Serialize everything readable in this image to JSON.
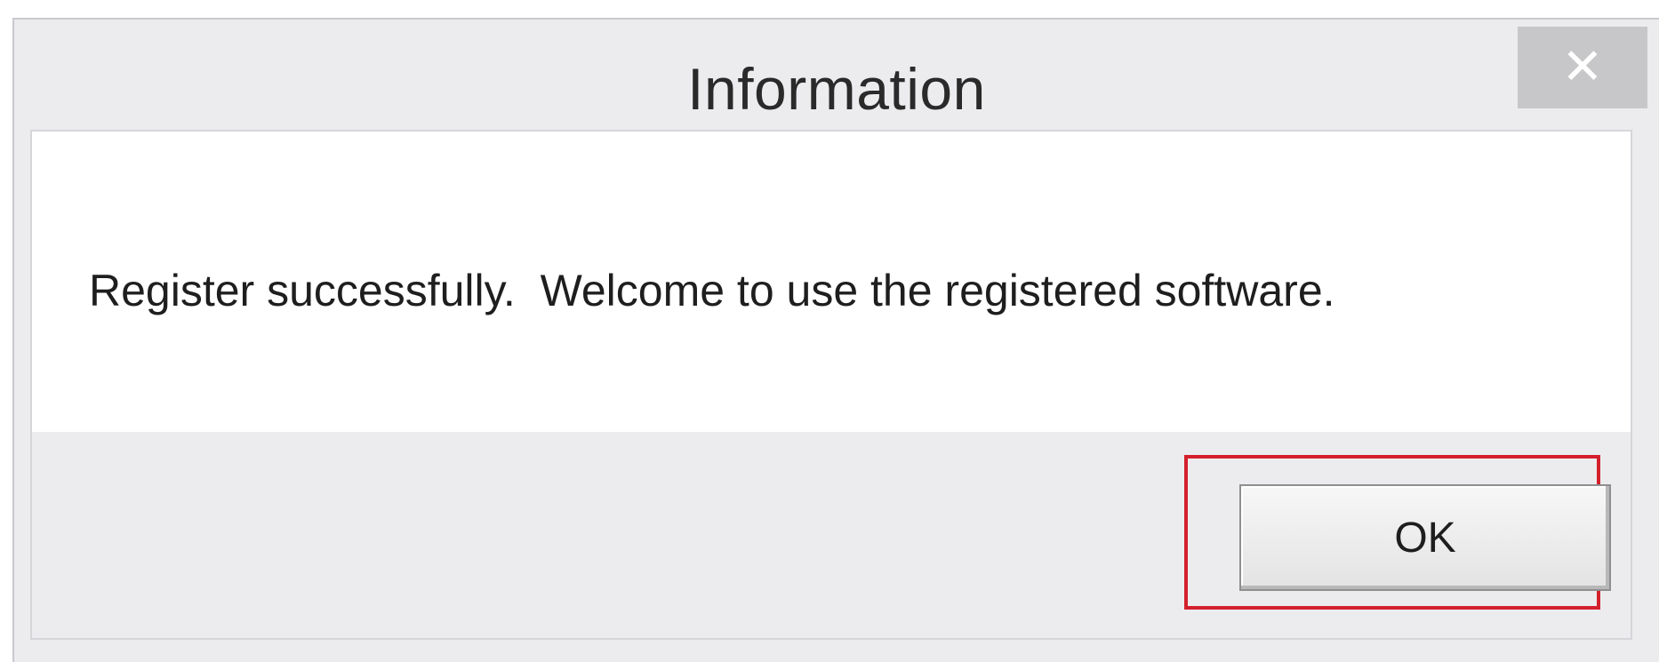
{
  "window": {
    "title": "Information",
    "close_icon": "close-icon",
    "close_glyph": "✕"
  },
  "message": {
    "text": "Register successfully.  Welcome to use the registered software."
  },
  "buttons": {
    "ok_label": "OK"
  },
  "colors": {
    "dialog_background": "#ececef",
    "message_background": "#ffffff",
    "close_button_background": "#c7c7c9",
    "highlight_border": "#d4202c"
  }
}
